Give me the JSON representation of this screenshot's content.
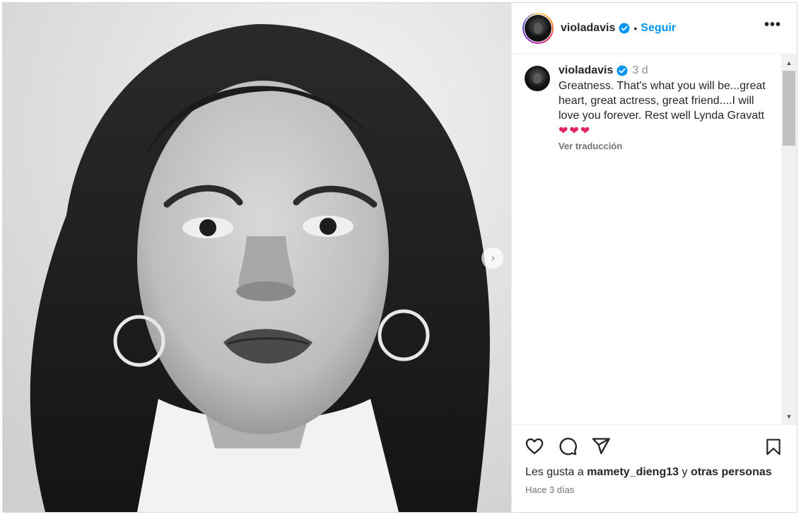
{
  "post": {
    "username": "violadavis",
    "follow_label": "Seguir",
    "separator": "•",
    "more_label": "•••",
    "next_label": "›"
  },
  "caption": {
    "username": "violadavis",
    "time": "3 d",
    "text": "Greatness. That's what you will be...great heart, great actress, great friend....I will love you forever. Rest well Lynda Gravatt",
    "hearts": "❤❤❤",
    "translate_label": "Ver traducción"
  },
  "likes": {
    "prefix": "Les gusta a",
    "user": "mamety_dieng13",
    "conjunction": "y",
    "others": "otras personas"
  },
  "posted_ago": "Hace 3 días",
  "icons": {
    "verified": "verified-badge-icon",
    "like": "heart-icon",
    "comment": "comment-icon",
    "share": "send-icon",
    "save": "bookmark-icon",
    "next": "chevron-right-icon",
    "more": "more-options-icon"
  },
  "colors": {
    "accent": "#0095f6",
    "text": "#262626",
    "muted": "#8e8e8e",
    "heart": "#e0245e"
  }
}
